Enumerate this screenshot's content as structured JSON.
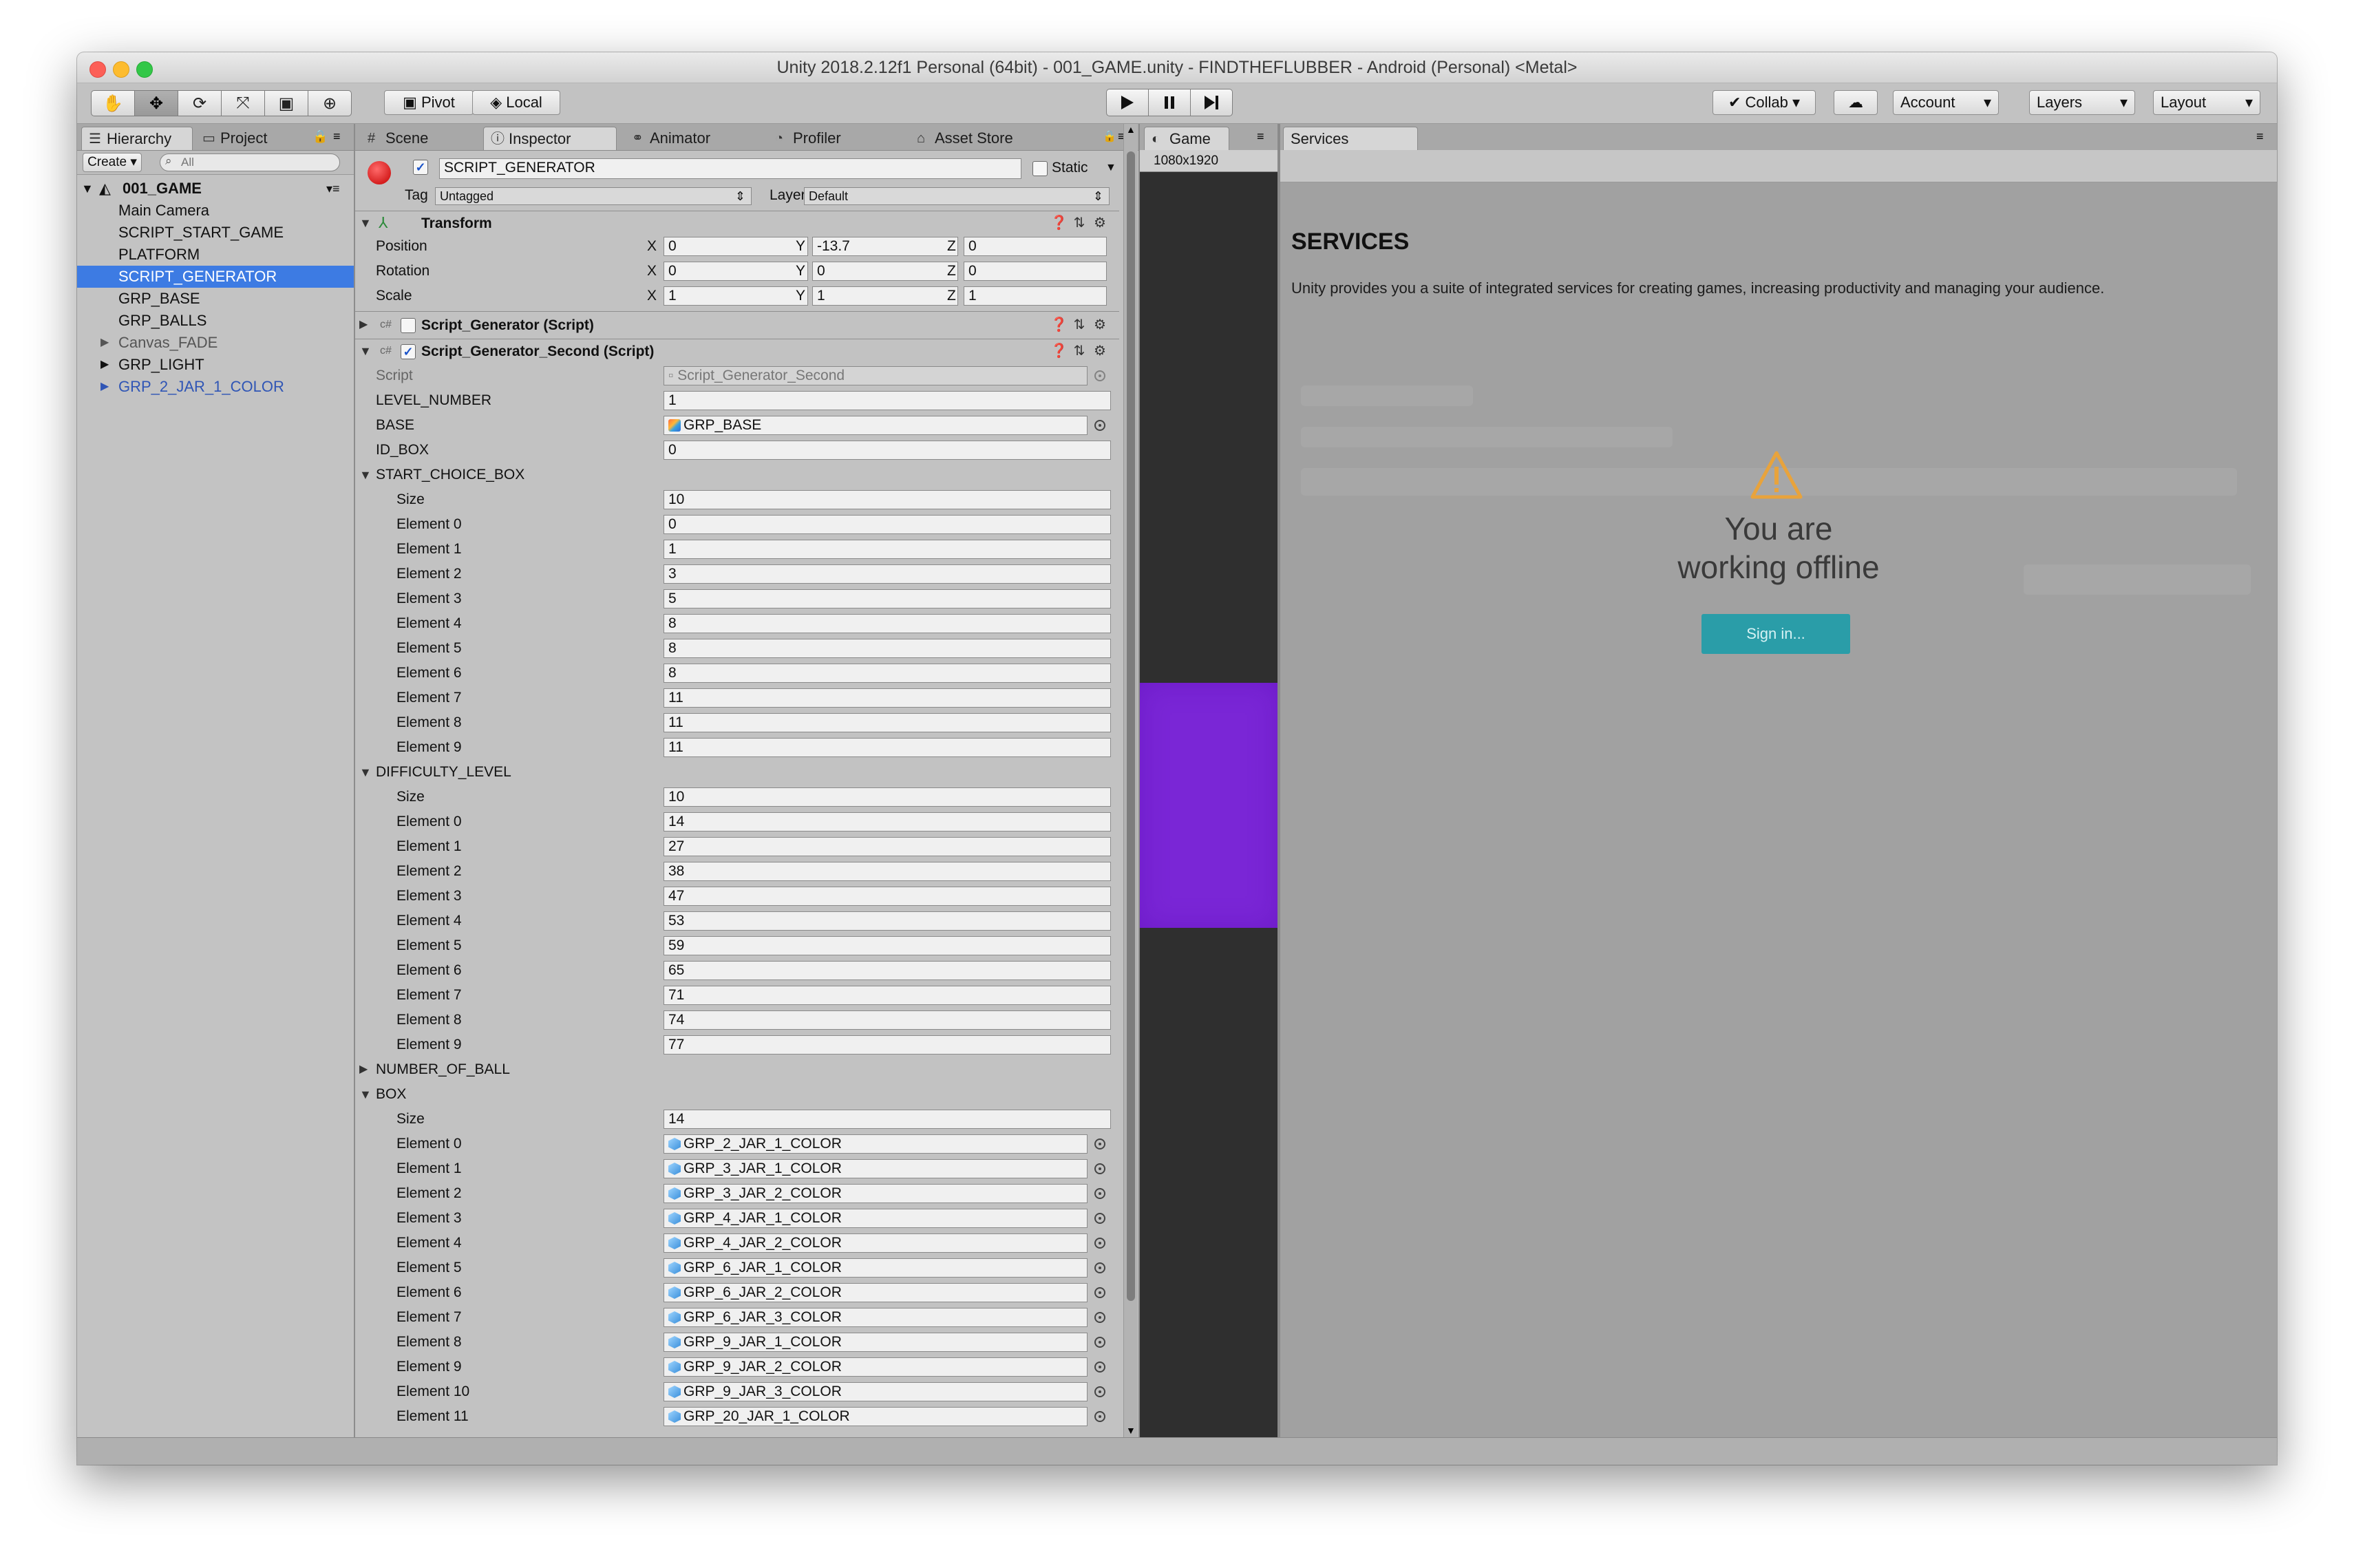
{
  "window": {
    "title": "Unity 2018.2.12f1 Personal (64bit) - 001_GAME.unity - FINDTHEFLUBBER - Android (Personal) <Metal>"
  },
  "toolbar": {
    "pivot": "Pivot",
    "local": "Local",
    "collab": "Collab",
    "account": "Account",
    "layers": "Layers",
    "layout": "Layout"
  },
  "hierarchy": {
    "tab": "Hierarchy",
    "project_tab": "Project",
    "create": "Create",
    "search_placeholder": "All",
    "scene": "001_GAME",
    "items": [
      {
        "label": "Main Camera"
      },
      {
        "label": "SCRIPT_START_GAME"
      },
      {
        "label": "PLATFORM"
      },
      {
        "label": "SCRIPT_GENERATOR"
      },
      {
        "label": "GRP_BASE"
      },
      {
        "label": "GRP_BALLS"
      },
      {
        "label": "Canvas_FADE"
      },
      {
        "label": "GRP_LIGHT"
      },
      {
        "label": "GRP_2_JAR_1_COLOR"
      }
    ]
  },
  "tabs": {
    "scene": "Scene",
    "inspector": "Inspector",
    "animator": "Animator",
    "profiler": "Profiler",
    "asset_store": "Asset Store",
    "game": "Game",
    "services": "Services"
  },
  "inspector": {
    "object_name": "SCRIPT_GENERATOR",
    "static": "Static",
    "tag_label": "Tag",
    "tag": "Untagged",
    "layer_label": "Layer",
    "layer": "Default",
    "transform": {
      "title": "Transform",
      "position_label": "Position",
      "rotation_label": "Rotation",
      "scale_label": "Scale",
      "x": "X",
      "y": "Y",
      "z": "Z",
      "position": [
        "0",
        "-13.7",
        "0"
      ],
      "rotation": [
        "0",
        "0",
        "0"
      ],
      "scale": [
        "1",
        "1",
        "1"
      ]
    },
    "comp1": "Script_Generator (Script)",
    "comp2": "Script_Generator_Second (Script)",
    "script_label": "Script",
    "script_value": "Script_Generator_Second",
    "level_number_label": "LEVEL_NUMBER",
    "level_number": "1",
    "base_label": "BASE",
    "base": "GRP_BASE",
    "id_box_label": "ID_BOX",
    "id_box": "0",
    "start_choice_box": {
      "label": "START_CHOICE_BOX",
      "size_label": "Size",
      "size": "10",
      "elements": [
        "0",
        "1",
        "3",
        "5",
        "8",
        "8",
        "8",
        "11",
        "11",
        "11"
      ]
    },
    "difficulty_level": {
      "label": "DIFFICULTY_LEVEL",
      "size_label": "Size",
      "size": "10",
      "elements": [
        "14",
        "27",
        "38",
        "47",
        "53",
        "59",
        "65",
        "71",
        "74",
        "77"
      ]
    },
    "number_of_ball_label": "NUMBER_OF_BALL",
    "box": {
      "label": "BOX",
      "size_label": "Size",
      "size": "14",
      "elements": [
        "GRP_2_JAR_1_COLOR",
        "GRP_3_JAR_1_COLOR",
        "GRP_3_JAR_2_COLOR",
        "GRP_4_JAR_1_COLOR",
        "GRP_4_JAR_2_COLOR",
        "GRP_6_JAR_1_COLOR",
        "GRP_6_JAR_2_COLOR",
        "GRP_6_JAR_3_COLOR",
        "GRP_9_JAR_1_COLOR",
        "GRP_9_JAR_2_COLOR",
        "GRP_9_JAR_3_COLOR",
        "GRP_20_JAR_1_COLOR"
      ]
    },
    "element_prefix": "Element"
  },
  "game": {
    "resolution": "1080x1920"
  },
  "services": {
    "heading": "SERVICES",
    "description": "Unity provides you a suite of integrated services for creating games, increasing productivity and managing your audience.",
    "offline_line1": "You are",
    "offline_line2": "working offline",
    "sign_in": "Sign in..."
  },
  "colors": {
    "selection": "#3d7be3",
    "sign_in_button": "#2a9da8",
    "game_object": "#7a26d6",
    "warning": "#e8a33c"
  }
}
